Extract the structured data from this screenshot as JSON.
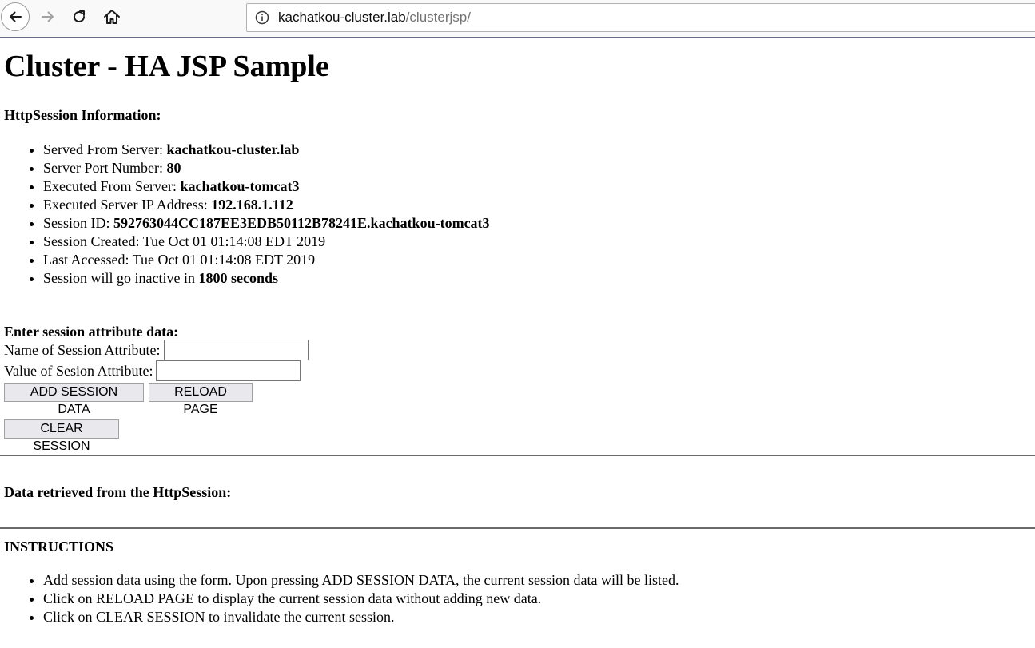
{
  "browser": {
    "url_host": "kachatkou-cluster.lab",
    "url_path": "/clusterjsp/"
  },
  "page": {
    "title": "Cluster - HA JSP Sample",
    "session_info_heading": "HttpSession Information:",
    "session_info": [
      {
        "label": "Served From Server: ",
        "value": "kachatkou-cluster.lab",
        "suffix": ""
      },
      {
        "label": "Server Port Number: ",
        "value": "80",
        "suffix": ""
      },
      {
        "label": "Executed From Server: ",
        "value": "kachatkou-tomcat3",
        "suffix": ""
      },
      {
        "label": "Executed Server IP Address: ",
        "value": "192.168.1.112",
        "suffix": ""
      },
      {
        "label": "Session ID: ",
        "value": "592763044CC187EE3EDB50112B78241E.kachatkou-tomcat3",
        "suffix": ""
      },
      {
        "label": "Session Created: Tue Oct 01 01:14:08 EDT 2019",
        "value": "",
        "suffix": ""
      },
      {
        "label": "Last Accessed: Tue Oct 01 01:14:08 EDT 2019",
        "value": "",
        "suffix": ""
      },
      {
        "label": "Session will go inactive in ",
        "value": "1800 seconds",
        "suffix": ""
      }
    ],
    "form": {
      "heading": "Enter session attribute data:",
      "name_label": "Name of Session Attribute:",
      "name_value": "",
      "value_label": "Value of Sesion Attribute:",
      "value_value": "",
      "add_button": "ADD SESSION DATA",
      "reload_button": "RELOAD PAGE",
      "clear_button": "CLEAR SESSION"
    },
    "retrieved_heading": "Data retrieved from the HttpSession:",
    "instructions_heading": "INSTRUCTIONS",
    "instructions": [
      "Add session data using the form. Upon pressing ADD SESSION DATA, the current session data will be listed.",
      "Click on RELOAD PAGE to display the current session data without adding new data.",
      "Click on CLEAR SESSION to invalidate the current session."
    ]
  }
}
